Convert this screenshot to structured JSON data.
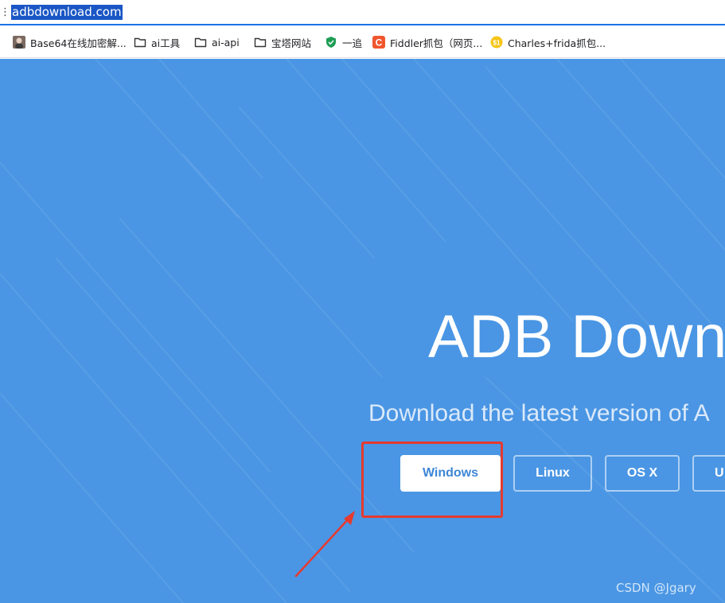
{
  "browser": {
    "address": {
      "url": "adbdownload.com"
    },
    "bookmarks": [
      {
        "label": "Base64在线加密解...",
        "icon": "avatar-icon"
      },
      {
        "label": "ai工具",
        "icon": "folder-icon"
      },
      {
        "label": "ai-api",
        "icon": "folder-icon"
      },
      {
        "label": "宝塔网站",
        "icon": "folder-icon"
      },
      {
        "label": "一追",
        "icon": "green-shield-icon"
      },
      {
        "label": "Fiddler抓包（网页...",
        "icon": "c-logo-icon"
      },
      {
        "label": "Charles+frida抓包...",
        "icon": "coin-icon"
      }
    ]
  },
  "hero": {
    "title": "ADB Down",
    "subtitle": "Download the latest version of A",
    "buttons": [
      {
        "label": "Windows"
      },
      {
        "label": "Linux"
      },
      {
        "label": "OS X"
      },
      {
        "label": "U"
      }
    ]
  },
  "annotation": {
    "highlight_color": "#e63a2e"
  },
  "watermark": {
    "text": "CSDN @Jgary"
  },
  "colors": {
    "hero_bg": "#4a96e4",
    "address_focus": "#1a73e8",
    "url_highlight": "#1a56c5"
  }
}
